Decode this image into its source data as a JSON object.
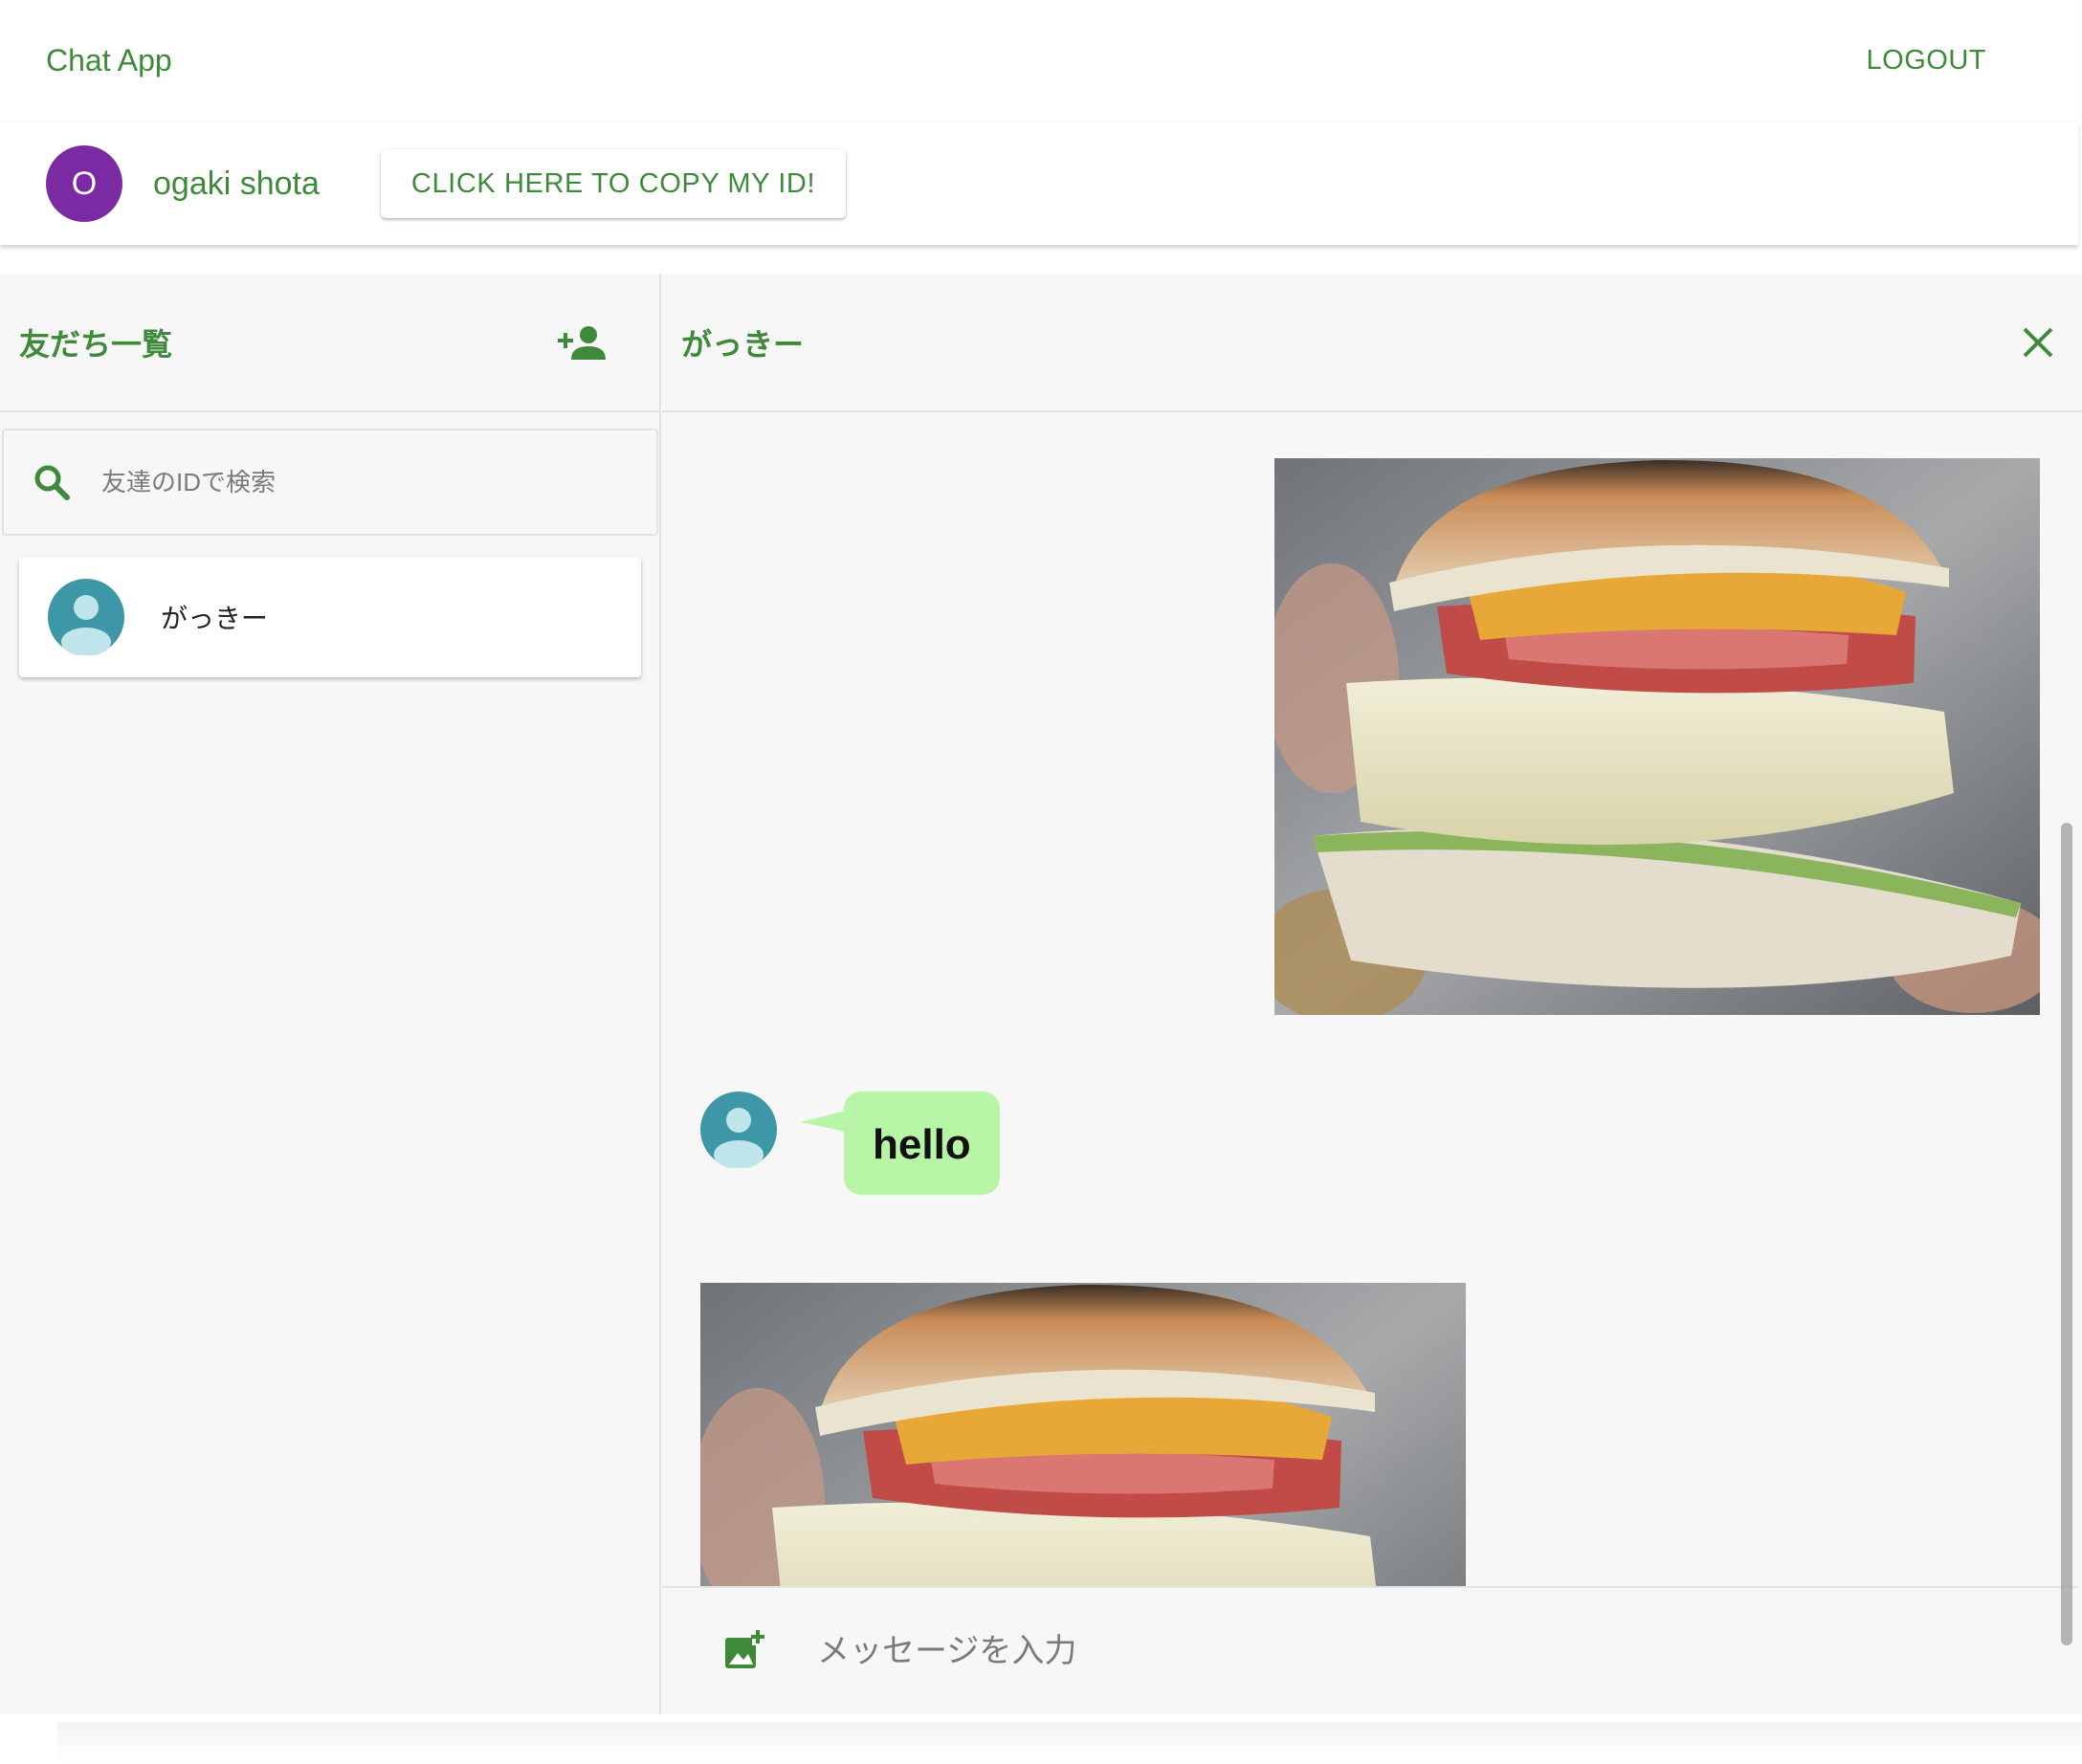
{
  "app": {
    "title": "Chat App",
    "logout_label": "LOGOUT"
  },
  "user": {
    "avatar_initial": "O",
    "name": "ogaki shota",
    "copy_id_label": "CLICK HERE TO COPY MY ID!",
    "avatar_color": "#7b2aa4"
  },
  "friends_panel": {
    "title": "友だち一覧",
    "search_placeholder": "友達のIDで検索",
    "friends": [
      {
        "name": "がっきー"
      }
    ]
  },
  "chat": {
    "partner_name": "がっきー",
    "messages": [
      {
        "type": "image",
        "direction": "sent"
      },
      {
        "type": "text",
        "direction": "received",
        "text": "hello"
      },
      {
        "type": "image",
        "direction": "received"
      }
    ],
    "input_placeholder": "メッセージを入力"
  },
  "colors": {
    "accent": "#3f8a3a",
    "bubble": "#b9f5a6",
    "background": "#f7f7f7",
    "default_avatar": "#3d97a6"
  },
  "icons": {
    "add_friend": "person-add-icon",
    "search": "search-icon",
    "close": "close-icon",
    "add_image": "add-photo-icon"
  }
}
